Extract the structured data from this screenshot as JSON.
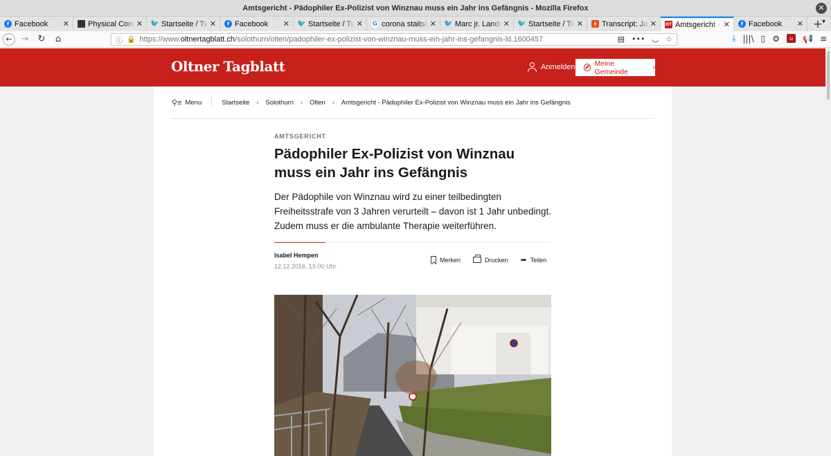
{
  "window": {
    "title": "Amtsgericht - Pädophiler Ex-Polizist von Winznau muss ein Jahr ins Gefängnis - Mozilla Firefox"
  },
  "tabs": [
    {
      "label": "Facebook",
      "icon": "facebook-icon"
    },
    {
      "label": "Physical Control",
      "icon": "page-icon"
    },
    {
      "label": "Startseite / Twitter",
      "icon": "twitter-icon"
    },
    {
      "label": "Facebook",
      "icon": "facebook-icon"
    },
    {
      "label": "Startseite / Twitter",
      "icon": "twitter-icon"
    },
    {
      "label": "corona staitsik schweiz",
      "icon": "google-icon"
    },
    {
      "label": "Marc jr. Landolt",
      "icon": "twitter-icon"
    },
    {
      "label": "Startseite / Twitter",
      "icon": "twitter-icon"
    },
    {
      "label": "Transcript: Jacob",
      "icon": "transcript-icon"
    },
    {
      "label": "Amtsgericht - Pädophiler",
      "icon": "ot-icon",
      "active": true
    },
    {
      "label": "Facebook",
      "icon": "facebook-icon"
    }
  ],
  "urlbar": {
    "prefix": "https://www.",
    "domain": "oltnertagblatt.ch",
    "path": "/solothurn/olten/padophiler-ex-polizist-von-winznau-muss-ein-jahr-ins-gefangnis-ld.1600457"
  },
  "site": {
    "logo": "Oltner Tagblatt",
    "login": "Anmelden",
    "gemeinde": "Meine Gemeinde",
    "brand_color": "#c8201b"
  },
  "breadcrumb": {
    "menu": "Menu",
    "items": [
      "Startseite",
      "Solothurn",
      "Olten",
      "Amtsgericht - Pädophiler Ex-Polizist von Winznau muss ein Jahr ins Gefängnis"
    ]
  },
  "article": {
    "kicker": "AMTSGERICHT",
    "headline": "Pädophiler Ex-Polizist von Winznau muss ein Jahr ins Gefängnis",
    "lead": "Der Pädophile von Winznau wird zu einer teilbedingten Freiheitsstrafe von 3 Jahren verurteilt – davon ist 1 Jahr unbedingt. Zudem muss er die ambulante Therapie weiterführen.",
    "author": "Isabel Hempen",
    "date": "12.12.2016, 19.00 Uhr",
    "actions": {
      "bookmark": "Merken",
      "print": "Drucken",
      "share": "Teilen"
    }
  }
}
